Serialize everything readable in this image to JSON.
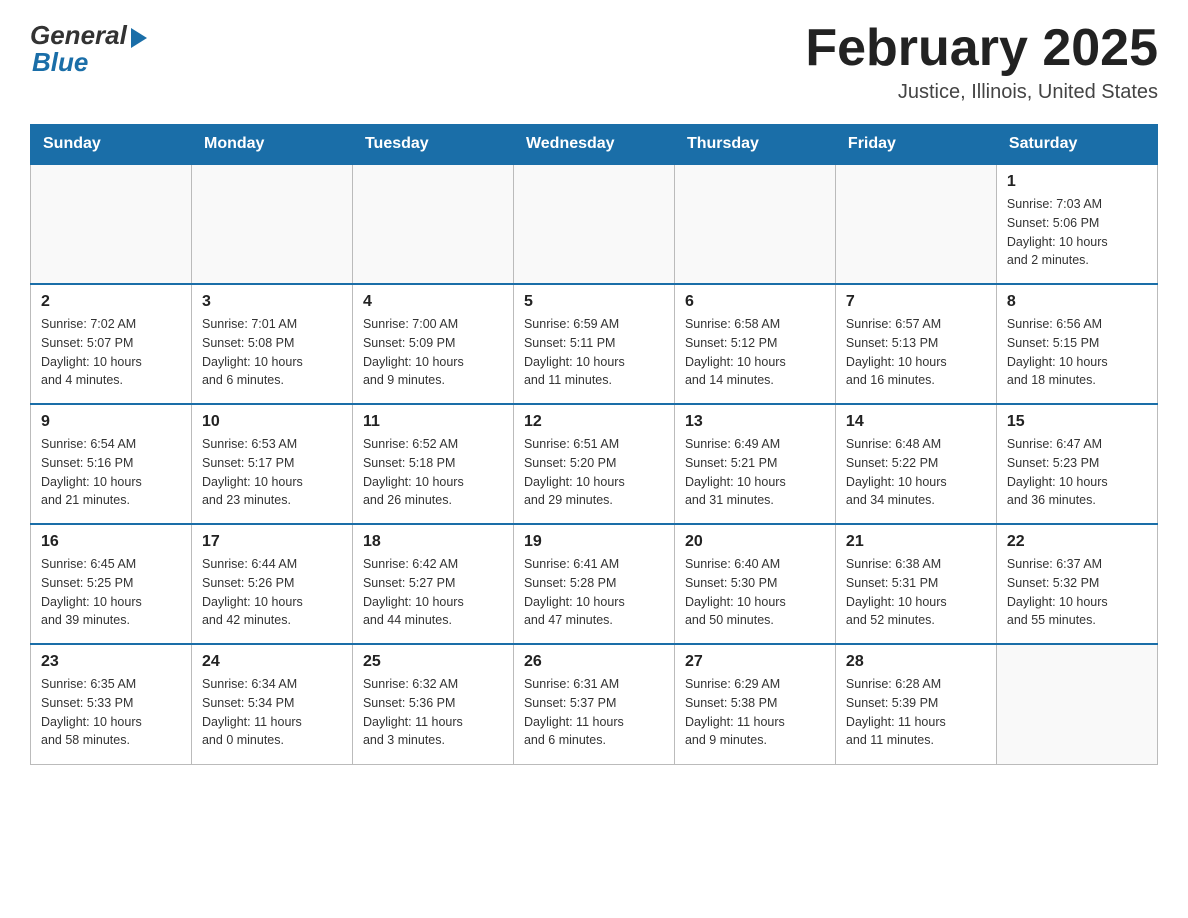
{
  "header": {
    "logo_general": "General",
    "logo_blue": "Blue",
    "month_title": "February 2025",
    "location": "Justice, Illinois, United States"
  },
  "days_of_week": [
    "Sunday",
    "Monday",
    "Tuesday",
    "Wednesday",
    "Thursday",
    "Friday",
    "Saturday"
  ],
  "weeks": [
    [
      {
        "day": "",
        "info": ""
      },
      {
        "day": "",
        "info": ""
      },
      {
        "day": "",
        "info": ""
      },
      {
        "day": "",
        "info": ""
      },
      {
        "day": "",
        "info": ""
      },
      {
        "day": "",
        "info": ""
      },
      {
        "day": "1",
        "info": "Sunrise: 7:03 AM\nSunset: 5:06 PM\nDaylight: 10 hours\nand 2 minutes."
      }
    ],
    [
      {
        "day": "2",
        "info": "Sunrise: 7:02 AM\nSunset: 5:07 PM\nDaylight: 10 hours\nand 4 minutes."
      },
      {
        "day": "3",
        "info": "Sunrise: 7:01 AM\nSunset: 5:08 PM\nDaylight: 10 hours\nand 6 minutes."
      },
      {
        "day": "4",
        "info": "Sunrise: 7:00 AM\nSunset: 5:09 PM\nDaylight: 10 hours\nand 9 minutes."
      },
      {
        "day": "5",
        "info": "Sunrise: 6:59 AM\nSunset: 5:11 PM\nDaylight: 10 hours\nand 11 minutes."
      },
      {
        "day": "6",
        "info": "Sunrise: 6:58 AM\nSunset: 5:12 PM\nDaylight: 10 hours\nand 14 minutes."
      },
      {
        "day": "7",
        "info": "Sunrise: 6:57 AM\nSunset: 5:13 PM\nDaylight: 10 hours\nand 16 minutes."
      },
      {
        "day": "8",
        "info": "Sunrise: 6:56 AM\nSunset: 5:15 PM\nDaylight: 10 hours\nand 18 minutes."
      }
    ],
    [
      {
        "day": "9",
        "info": "Sunrise: 6:54 AM\nSunset: 5:16 PM\nDaylight: 10 hours\nand 21 minutes."
      },
      {
        "day": "10",
        "info": "Sunrise: 6:53 AM\nSunset: 5:17 PM\nDaylight: 10 hours\nand 23 minutes."
      },
      {
        "day": "11",
        "info": "Sunrise: 6:52 AM\nSunset: 5:18 PM\nDaylight: 10 hours\nand 26 minutes."
      },
      {
        "day": "12",
        "info": "Sunrise: 6:51 AM\nSunset: 5:20 PM\nDaylight: 10 hours\nand 29 minutes."
      },
      {
        "day": "13",
        "info": "Sunrise: 6:49 AM\nSunset: 5:21 PM\nDaylight: 10 hours\nand 31 minutes."
      },
      {
        "day": "14",
        "info": "Sunrise: 6:48 AM\nSunset: 5:22 PM\nDaylight: 10 hours\nand 34 minutes."
      },
      {
        "day": "15",
        "info": "Sunrise: 6:47 AM\nSunset: 5:23 PM\nDaylight: 10 hours\nand 36 minutes."
      }
    ],
    [
      {
        "day": "16",
        "info": "Sunrise: 6:45 AM\nSunset: 5:25 PM\nDaylight: 10 hours\nand 39 minutes."
      },
      {
        "day": "17",
        "info": "Sunrise: 6:44 AM\nSunset: 5:26 PM\nDaylight: 10 hours\nand 42 minutes."
      },
      {
        "day": "18",
        "info": "Sunrise: 6:42 AM\nSunset: 5:27 PM\nDaylight: 10 hours\nand 44 minutes."
      },
      {
        "day": "19",
        "info": "Sunrise: 6:41 AM\nSunset: 5:28 PM\nDaylight: 10 hours\nand 47 minutes."
      },
      {
        "day": "20",
        "info": "Sunrise: 6:40 AM\nSunset: 5:30 PM\nDaylight: 10 hours\nand 50 minutes."
      },
      {
        "day": "21",
        "info": "Sunrise: 6:38 AM\nSunset: 5:31 PM\nDaylight: 10 hours\nand 52 minutes."
      },
      {
        "day": "22",
        "info": "Sunrise: 6:37 AM\nSunset: 5:32 PM\nDaylight: 10 hours\nand 55 minutes."
      }
    ],
    [
      {
        "day": "23",
        "info": "Sunrise: 6:35 AM\nSunset: 5:33 PM\nDaylight: 10 hours\nand 58 minutes."
      },
      {
        "day": "24",
        "info": "Sunrise: 6:34 AM\nSunset: 5:34 PM\nDaylight: 11 hours\nand 0 minutes."
      },
      {
        "day": "25",
        "info": "Sunrise: 6:32 AM\nSunset: 5:36 PM\nDaylight: 11 hours\nand 3 minutes."
      },
      {
        "day": "26",
        "info": "Sunrise: 6:31 AM\nSunset: 5:37 PM\nDaylight: 11 hours\nand 6 minutes."
      },
      {
        "day": "27",
        "info": "Sunrise: 6:29 AM\nSunset: 5:38 PM\nDaylight: 11 hours\nand 9 minutes."
      },
      {
        "day": "28",
        "info": "Sunrise: 6:28 AM\nSunset: 5:39 PM\nDaylight: 11 hours\nand 11 minutes."
      },
      {
        "day": "",
        "info": ""
      }
    ]
  ]
}
